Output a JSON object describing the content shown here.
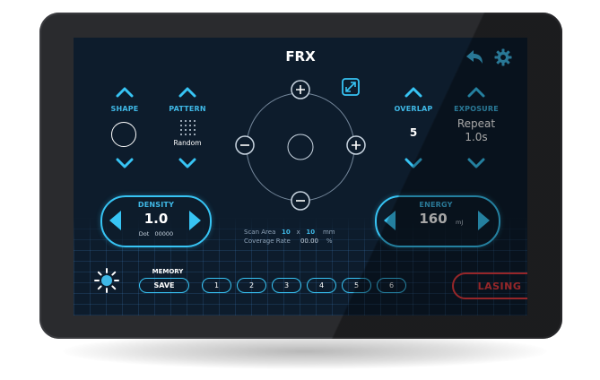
{
  "title": "FRX",
  "shape": {
    "label": "SHAPE"
  },
  "pattern": {
    "label": "PATTERN",
    "value": "Random"
  },
  "overlap": {
    "label": "OVERLAP",
    "value": "5"
  },
  "exposure": {
    "label": "EXPOSURE",
    "value_line1": "Repeat",
    "value_line2": "1.0s"
  },
  "density": {
    "label": "DENSITY",
    "value": "1.0",
    "dot_label": "Dot",
    "dot_value": "00000"
  },
  "energy": {
    "label": "ENERGY",
    "value": "160",
    "unit": "mJ"
  },
  "scan_area": {
    "label": "Scan Area",
    "x": "10",
    "sep": "x",
    "y": "10",
    "unit": "mm"
  },
  "coverage": {
    "label": "Coverage Rate",
    "value": "00.00",
    "unit": "%"
  },
  "memory": {
    "label": "MEMORY",
    "save_label": "SAVE",
    "slots": [
      "1",
      "2",
      "3",
      "4",
      "5",
      "6"
    ]
  },
  "lasing_label": "LASING",
  "icons": {
    "back": "back-arrow-icon",
    "settings": "gear-icon",
    "expand": "expand-icon",
    "brightness": "sun-icon"
  },
  "colors": {
    "accent": "#37c4f4",
    "alert": "#e63b3f",
    "screen_bg": "#0d1c2c"
  }
}
